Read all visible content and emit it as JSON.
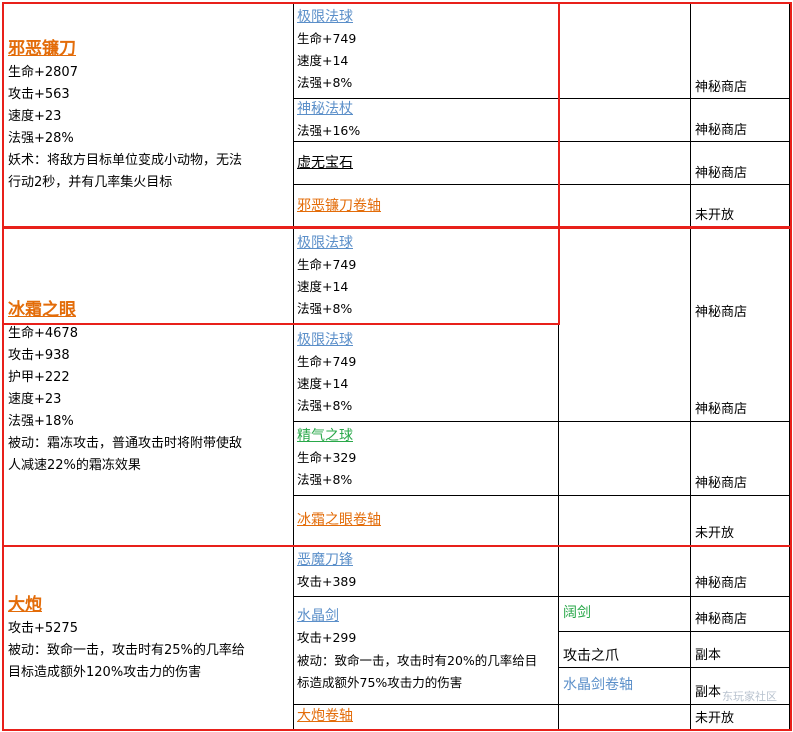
{
  "watermark": "东玩家社区",
  "sections": [
    {
      "title": "邪恶镰刀",
      "stats": [
        "生命+2807",
        "攻击+563",
        "速度+23",
        "法强+28%"
      ],
      "desc": [
        "妖术：将敌方目标单位变成小动物，无法",
        "行动2秒，并有几率集火目标"
      ],
      "components": [
        {
          "name": "极限法球",
          "stats": [
            "生命+749",
            "速度+14",
            "法强+8%"
          ],
          "source": "神秘商店"
        },
        {
          "name": "神秘法杖",
          "stats": [
            "法强+16%"
          ],
          "source": "神秘商店"
        },
        {
          "name": "虚无宝石",
          "stats": [],
          "source": "神秘商店"
        },
        {
          "name": "邪恶镰刀卷轴",
          "stats": [],
          "source": "未开放"
        }
      ]
    },
    {
      "title": "冰霜之眼",
      "stats": [
        "生命+4678",
        "攻击+938",
        "护甲+222",
        "速度+23",
        "法强+18%"
      ],
      "desc": [
        "被动：霜冻攻击，普通攻击时将附带使敌",
        "人减速22%的霜冻效果"
      ],
      "components": [
        {
          "name": "极限法球",
          "stats": [
            "生命+749",
            "速度+14",
            "法强+8%"
          ],
          "source": "神秘商店"
        },
        {
          "name": "极限法球",
          "stats": [
            "生命+749",
            "速度+14",
            "法强+8%"
          ],
          "source": "神秘商店"
        },
        {
          "name": "精气之球",
          "stats": [
            "生命+329",
            "法强+8%"
          ],
          "source": "神秘商店"
        },
        {
          "name": "冰霜之眼卷轴",
          "stats": [],
          "source": "未开放"
        }
      ]
    },
    {
      "title": "大炮",
      "stats": [
        "攻击+5275"
      ],
      "desc": [
        "被动：致命一击，攻击时有25%的几率给",
        "目标造成额外120%攻击力的伤害"
      ],
      "components": [
        {
          "name": "恶魔刀锋",
          "stats": [
            "攻击+389"
          ],
          "source": "神秘商店"
        },
        {
          "name": "水晶剑",
          "stats": [
            "攻击+299"
          ],
          "desc": [
            "被动：致命一击，攻击时有20%的几率给目",
            "标造成额外75%攻击力的伤害"
          ],
          "subparts": [
            {
              "name": "阔剑",
              "source": "神秘商店"
            },
            {
              "name": "攻击之爪",
              "source": "副本"
            },
            {
              "name": "水晶剑卷轴",
              "source": "副本"
            }
          ]
        },
        {
          "name": "大炮卷轴",
          "stats": [],
          "source": "未开放"
        }
      ]
    }
  ]
}
